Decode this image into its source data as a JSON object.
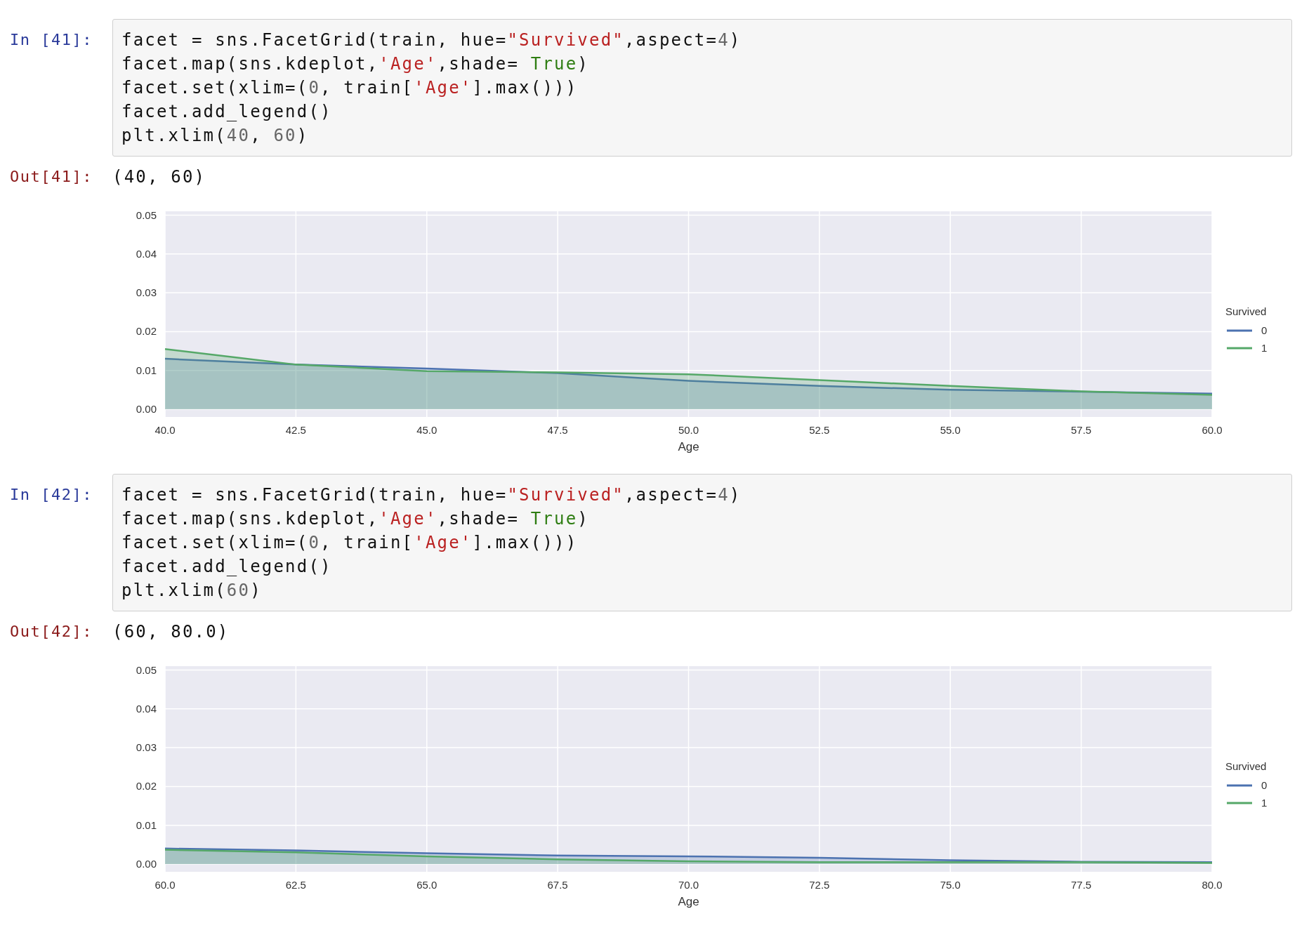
{
  "cells": [
    {
      "input_prompt": "In [41]:",
      "code": [
        [
          {
            "text": "facet = sns.FacetGrid(train, hue=",
            "kind": "plain"
          },
          {
            "text": "\"Survived\"",
            "kind": "string"
          },
          {
            "text": ",aspect=",
            "kind": "plain"
          },
          {
            "text": "4",
            "kind": "number"
          },
          {
            "text": ")",
            "kind": "plain"
          }
        ],
        [
          {
            "text": "facet.map(sns.kdeplot,",
            "kind": "plain"
          },
          {
            "text": "'Age'",
            "kind": "string"
          },
          {
            "text": ",shade= ",
            "kind": "plain"
          },
          {
            "text": "True",
            "kind": "keyword"
          },
          {
            "text": ")",
            "kind": "plain"
          }
        ],
        [
          {
            "text": "facet.set(xlim=(",
            "kind": "plain"
          },
          {
            "text": "0",
            "kind": "number"
          },
          {
            "text": ", train[",
            "kind": "plain"
          },
          {
            "text": "'Age'",
            "kind": "string"
          },
          {
            "text": "].max()))",
            "kind": "plain"
          }
        ],
        [
          {
            "text": "facet.add_legend()",
            "kind": "plain"
          }
        ],
        [
          {
            "text": "plt.xlim(",
            "kind": "plain"
          },
          {
            "text": "40",
            "kind": "number"
          },
          {
            "text": ", ",
            "kind": "plain"
          },
          {
            "text": "60",
            "kind": "number"
          },
          {
            "text": ")",
            "kind": "plain"
          }
        ]
      ],
      "output_prompt": "Out[41]:",
      "output_text": "(40, 60)",
      "chart_data": {
        "type": "area",
        "grid": true,
        "legend": {
          "title": "Survived"
        },
        "xlabel": "Age",
        "x": [
          40,
          42.5,
          45,
          47.5,
          50,
          52.5,
          55,
          57.5,
          60
        ],
        "xlim": [
          40,
          60
        ],
        "ylim": [
          -0.002,
          0.051
        ],
        "xticks": [
          {
            "value": 40,
            "label": "40.0"
          },
          {
            "value": 42.5,
            "label": "42.5"
          },
          {
            "value": 45,
            "label": "45.0"
          },
          {
            "value": 47.5,
            "label": "47.5"
          },
          {
            "value": 50,
            "label": "50.0"
          },
          {
            "value": 52.5,
            "label": "52.5"
          },
          {
            "value": 55,
            "label": "55.0"
          },
          {
            "value": 57.5,
            "label": "57.5"
          },
          {
            "value": 60,
            "label": "60.0"
          }
        ],
        "yticks": [
          {
            "value": 0,
            "label": "0.00"
          },
          {
            "value": 0.01,
            "label": "0.01"
          },
          {
            "value": 0.02,
            "label": "0.02"
          },
          {
            "value": 0.03,
            "label": "0.03"
          },
          {
            "value": 0.04,
            "label": "0.04"
          },
          {
            "value": 0.05,
            "label": "0.05"
          }
        ],
        "series": [
          {
            "name": "0",
            "color": "#4c72b0",
            "values": [
              0.013,
              0.0115,
              0.0105,
              0.0093,
              0.0073,
              0.006,
              0.005,
              0.0045,
              0.004
            ]
          },
          {
            "name": "1",
            "color": "#55a868",
            "values": [
              0.0155,
              0.0115,
              0.0098,
              0.0095,
              0.009,
              0.0075,
              0.006,
              0.0046,
              0.0037
            ]
          }
        ]
      }
    },
    {
      "input_prompt": "In [42]:",
      "code": [
        [
          {
            "text": "facet = sns.FacetGrid(train, hue=",
            "kind": "plain"
          },
          {
            "text": "\"Survived\"",
            "kind": "string"
          },
          {
            "text": ",aspect=",
            "kind": "plain"
          },
          {
            "text": "4",
            "kind": "number"
          },
          {
            "text": ")",
            "kind": "plain"
          }
        ],
        [
          {
            "text": "facet.map(sns.kdeplot,",
            "kind": "plain"
          },
          {
            "text": "'Age'",
            "kind": "string"
          },
          {
            "text": ",shade= ",
            "kind": "plain"
          },
          {
            "text": "True",
            "kind": "keyword"
          },
          {
            "text": ")",
            "kind": "plain"
          }
        ],
        [
          {
            "text": "facet.set(xlim=(",
            "kind": "plain"
          },
          {
            "text": "0",
            "kind": "number"
          },
          {
            "text": ", train[",
            "kind": "plain"
          },
          {
            "text": "'Age'",
            "kind": "string"
          },
          {
            "text": "].max()))",
            "kind": "plain"
          }
        ],
        [
          {
            "text": "facet.add_legend()",
            "kind": "plain"
          }
        ],
        [
          {
            "text": "plt.xlim(",
            "kind": "plain"
          },
          {
            "text": "60",
            "kind": "number"
          },
          {
            "text": ")",
            "kind": "plain"
          }
        ]
      ],
      "output_prompt": "Out[42]:",
      "output_text": "(60, 80.0)",
      "chart_data": {
        "type": "area",
        "grid": true,
        "legend": {
          "title": "Survived"
        },
        "xlabel": "Age",
        "x": [
          60,
          62.5,
          65,
          67.5,
          70,
          72.5,
          75,
          77.5,
          80
        ],
        "xlim": [
          60,
          80
        ],
        "ylim": [
          -0.002,
          0.051
        ],
        "xticks": [
          {
            "value": 60,
            "label": "60.0"
          },
          {
            "value": 62.5,
            "label": "62.5"
          },
          {
            "value": 65,
            "label": "65.0"
          },
          {
            "value": 67.5,
            "label": "67.5"
          },
          {
            "value": 70,
            "label": "70.0"
          },
          {
            "value": 72.5,
            "label": "72.5"
          },
          {
            "value": 75,
            "label": "75.0"
          },
          {
            "value": 77.5,
            "label": "77.5"
          },
          {
            "value": 80,
            "label": "80.0"
          }
        ],
        "yticks": [
          {
            "value": 0,
            "label": "0.00"
          },
          {
            "value": 0.01,
            "label": "0.01"
          },
          {
            "value": 0.02,
            "label": "0.02"
          },
          {
            "value": 0.03,
            "label": "0.03"
          },
          {
            "value": 0.04,
            "label": "0.04"
          },
          {
            "value": 0.05,
            "label": "0.05"
          }
        ],
        "series": [
          {
            "name": "0",
            "color": "#4c72b0",
            "values": [
              0.004,
              0.0035,
              0.0028,
              0.0022,
              0.002,
              0.0016,
              0.001,
              0.0006,
              0.0005
            ]
          },
          {
            "name": "1",
            "color": "#55a868",
            "values": [
              0.0037,
              0.003,
              0.002,
              0.0012,
              0.0007,
              0.0005,
              0.0005,
              0.0005,
              0.0003
            ]
          }
        ]
      }
    }
  ]
}
